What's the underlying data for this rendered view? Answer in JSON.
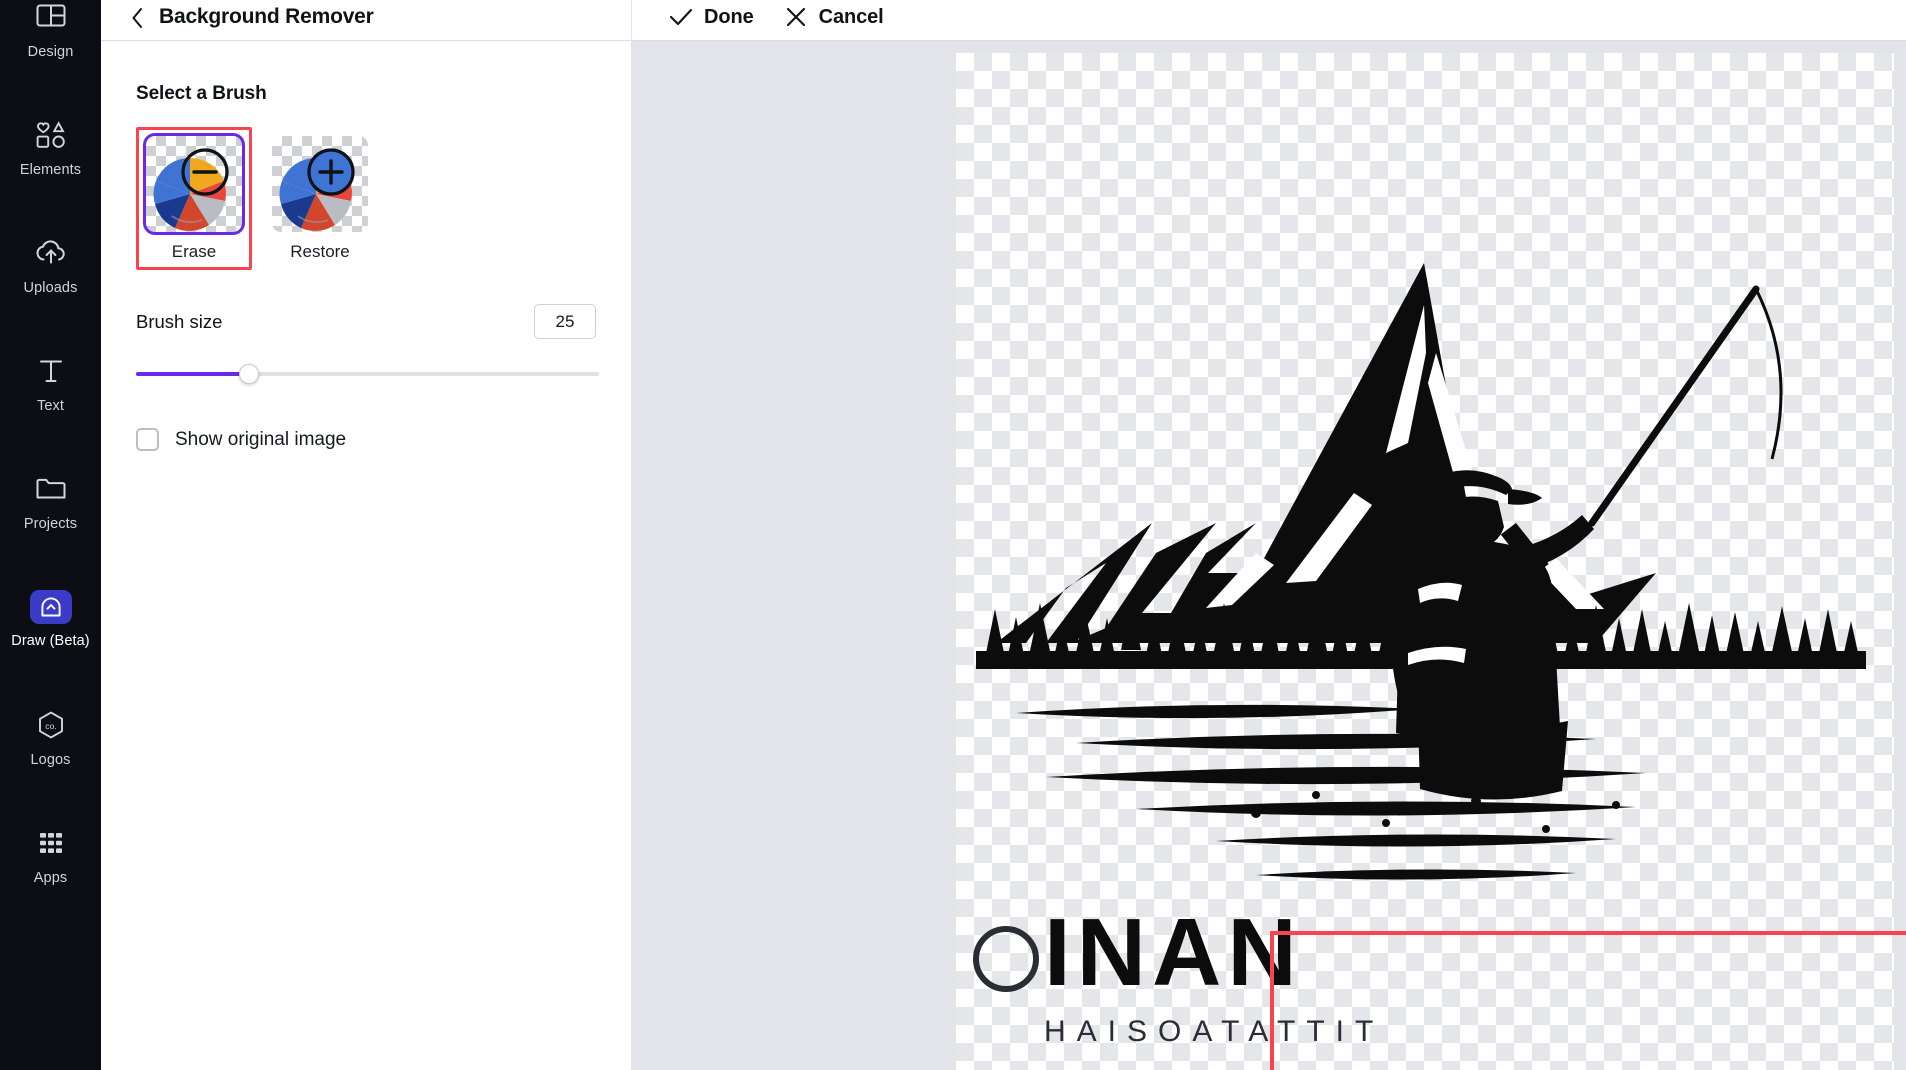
{
  "sidebar": {
    "items": [
      {
        "label": "Design",
        "icon": "layout-icon",
        "active": false
      },
      {
        "label": "Elements",
        "icon": "shapes-icon",
        "active": false
      },
      {
        "label": "Uploads",
        "icon": "upload-cloud-icon",
        "active": false
      },
      {
        "label": "Text",
        "icon": "text-t-icon",
        "active": false
      },
      {
        "label": "Projects",
        "icon": "folder-icon",
        "active": false
      },
      {
        "label": "Draw (Beta)",
        "icon": "draw-pen-icon",
        "active": true
      },
      {
        "label": "Logos",
        "icon": "logo-hex-icon",
        "active": false
      },
      {
        "label": "Apps",
        "icon": "grid-dots-icon",
        "active": false
      }
    ]
  },
  "panel": {
    "back_icon": "chevron-left-icon",
    "title": "Background Remover",
    "section_title": "Select a Brush",
    "brushes": [
      {
        "label": "Erase",
        "icon": "brush-erase-minus-icon",
        "selected": true,
        "annotated": true
      },
      {
        "label": "Restore",
        "icon": "brush-restore-plus-icon",
        "selected": false,
        "annotated": false
      }
    ],
    "brush_size": {
      "label": "Brush size",
      "value": "25",
      "min": 1,
      "max": 100,
      "fill_percent": "24.5%"
    },
    "show_original": {
      "label": "Show original image",
      "checked": false
    }
  },
  "stage": {
    "actions": [
      {
        "label": "Done",
        "icon": "check-icon"
      },
      {
        "label": "Cancel",
        "icon": "close-x-icon"
      }
    ],
    "canvas": {
      "background": "transparent-checkerboard",
      "artwork_alt": "fisherman-mountain-lake-silhouette",
      "wordmark_primary": "INAN",
      "wordmark_secondary": "HAISOATATTIT"
    }
  },
  "colors": {
    "rail_bg": "#0d0e13",
    "accent_purple": "#6a28e8",
    "active_chip": "#3a3cc7",
    "annotation_red": "#f8444f",
    "stage_bg": "#e2e4ea",
    "text_primary": "#0e1318"
  }
}
